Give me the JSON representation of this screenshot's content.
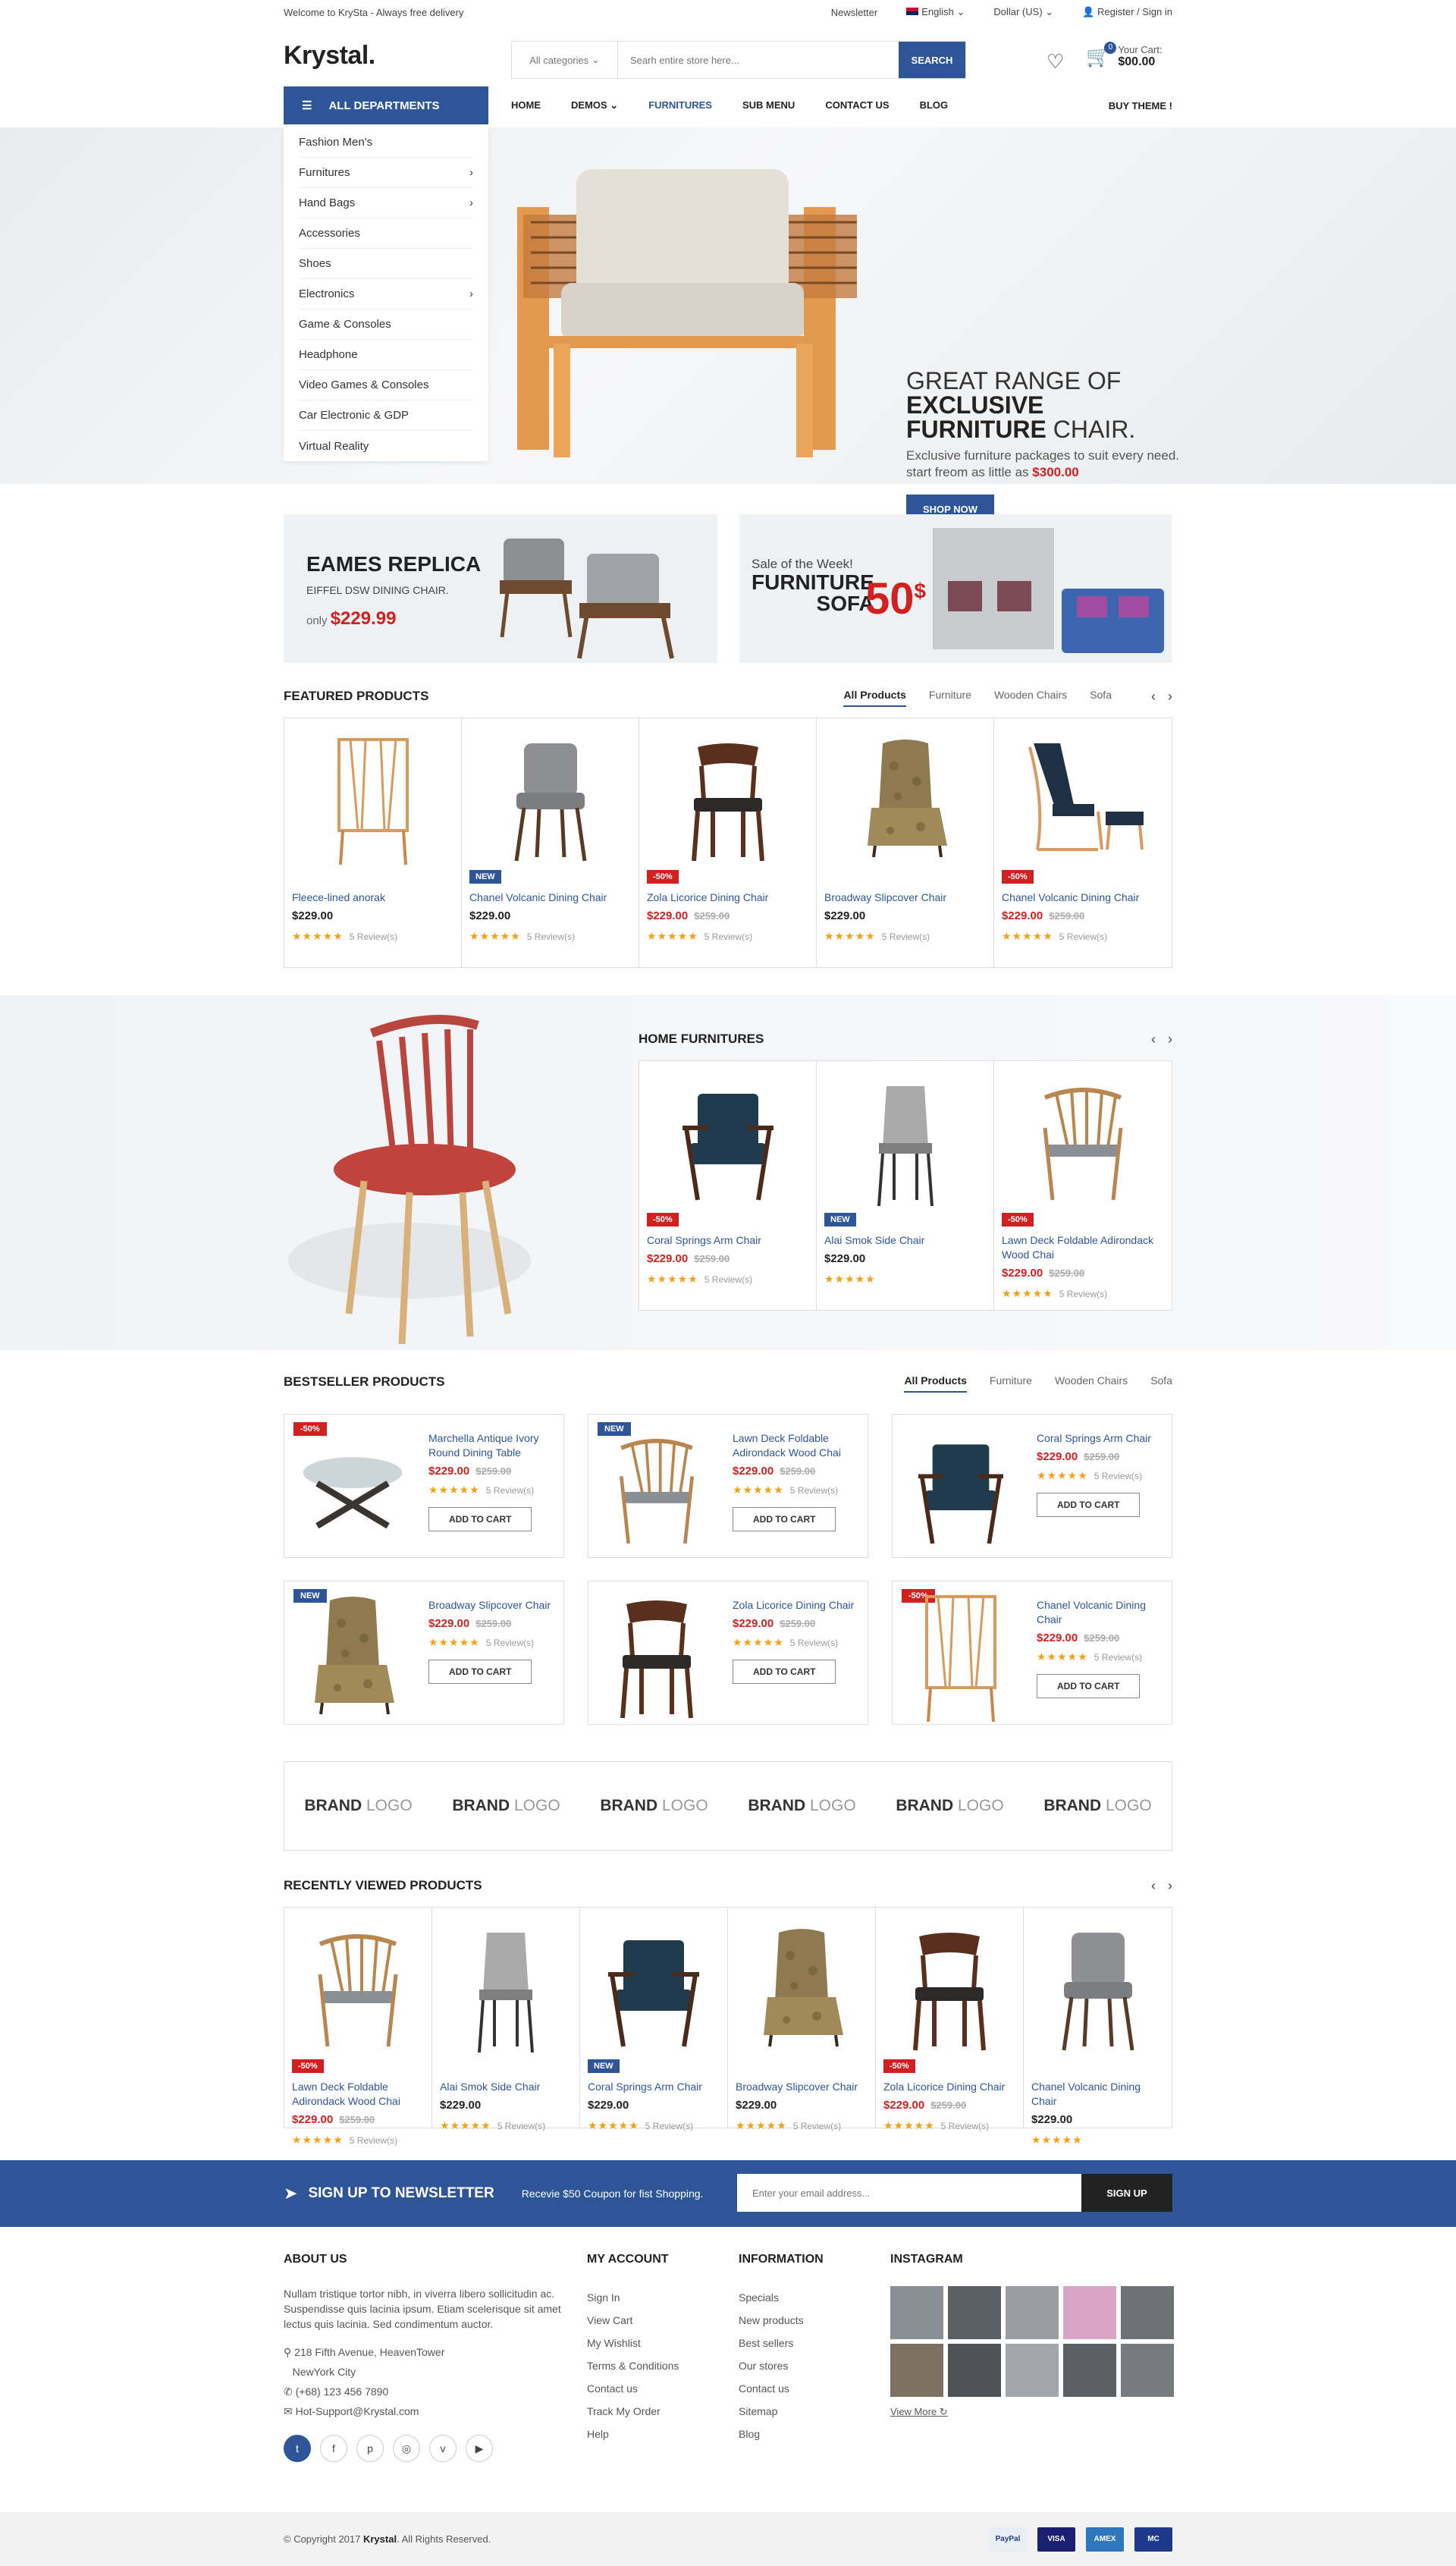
{
  "topbar": {
    "welcome": "Welcome to KrySta - Always free delivery",
    "newsletter": "Newsletter",
    "language": "English",
    "currency": "Dollar (US)",
    "account": "Register / Sign in"
  },
  "header": {
    "logo": "Krystal.",
    "category": "All categories",
    "search_placeholder": "Searh entire store here...",
    "search_button": "SEARCH",
    "cart_label": "Your Cart:",
    "cart_total": "$00.00",
    "cart_count": "0"
  },
  "nav": {
    "all_departments": "ALL DEPARTMENTS",
    "items": [
      "HOME",
      "DEMOS",
      "FURNITURES",
      "SUB MENU",
      "CONTACT US",
      "BLOG"
    ],
    "buy_theme": "BUY THEME !"
  },
  "departments": [
    "Fashion Men's",
    "Furnitures",
    "Hand Bags",
    "Accessories",
    "Shoes",
    "Electronics",
    "Game & Consoles",
    "Headphone",
    "Video Games & Consoles",
    "Car Electronic & GDP",
    "Virtual Reality"
  ],
  "hero": {
    "line1a": "GREAT RANGE OF ",
    "line1b": "EXCLUSIVE",
    "line2a": "FURNITURE",
    "line2b": " CHAIR.",
    "desc": "Exclusive furniture packages to suit every need.",
    "desc2": "start freom as little as ",
    "price": "$300.00",
    "button": "SHOP NOW"
  },
  "banner1": {
    "title": "EAMES REPLICA",
    "subtitle": "EIFFEL DSW DINING CHAIR.",
    "only": "only ",
    "price": "$229.99"
  },
  "banner2": {
    "sale": "Sale of the Week!",
    "line1": "FURNITURE",
    "line2": "SOFA",
    "value": "50",
    "currency": "$"
  },
  "featured": {
    "title": "FEATURED PRODUCTS",
    "tabs": [
      "All Products",
      "Furniture",
      "Wooden Chairs",
      "Sofa"
    ],
    "items": [
      {
        "name": "Fleece-lined anorak",
        "price": "$229.00",
        "old": "",
        "tag": "",
        "reviews": "5 Review(s)"
      },
      {
        "name": "Chanel Volcanic Dining Chair",
        "price": "$229.00",
        "old": "",
        "tag": "NEW",
        "reviews": "5 Review(s)"
      },
      {
        "name": "Zola Licorice Dining Chair",
        "price": "$229.00",
        "old": "$259.00",
        "tag": "-50%",
        "reviews": "5 Review(s)"
      },
      {
        "name": "Broadway Slipcover Chair",
        "price": "$229.00",
        "old": "",
        "tag": "",
        "reviews": "5 Review(s)"
      },
      {
        "name": "Chanel Volcanic Dining Chair",
        "price": "$229.00",
        "old": "$259.00",
        "tag": "-50%",
        "reviews": "5 Review(s)"
      }
    ]
  },
  "home": {
    "title": "HOME FURNITURES",
    "items": [
      {
        "name": "Coral Springs Arm Chair",
        "price": "$229.00",
        "old": "$259.00",
        "tag": "-50%",
        "reviews": "5 Review(s)"
      },
      {
        "name": "Alai Smok Side Chair",
        "price": "$229.00",
        "old": "",
        "tag": "NEW",
        "reviews": ""
      },
      {
        "name": "Lawn Deck Foldable Adirondack Wood Chai",
        "price": "$229.00",
        "old": "$259.00",
        "tag": "-50%",
        "reviews": "5 Review(s)"
      }
    ]
  },
  "bestseller": {
    "title": "BESTSELLER PRODUCTS",
    "tabs": [
      "All Products",
      "Furniture",
      "Wooden Chairs",
      "Sofa"
    ],
    "add_to_cart": "ADD TO CART",
    "items": [
      {
        "name": "Marchella Antique Ivory Round Dining Table",
        "price": "$229.00",
        "old": "$259.00",
        "tag": "-50%",
        "reviews": "5 Review(s)"
      },
      {
        "name": "Lawn Deck Foldable Adirondack Wood Chai",
        "price": "$229.00",
        "old": "$259.00",
        "tag": "NEW",
        "reviews": "5 Review(s)"
      },
      {
        "name": "Coral Springs Arm Chair",
        "price": "$229.00",
        "old": "$259.00",
        "tag": "",
        "reviews": "5 Review(s)"
      },
      {
        "name": "Broadway Slipcover Chair",
        "price": "$229.00",
        "old": "$259.00",
        "tag": "NEW",
        "reviews": "5 Review(s)"
      },
      {
        "name": "Zola Licorice Dining Chair",
        "price": "$229.00",
        "old": "$259.00",
        "tag": "",
        "reviews": "5 Review(s)"
      },
      {
        "name": "Chanel Volcanic Dining Chair",
        "price": "$229.00",
        "old": "$259.00",
        "tag": "-50%",
        "reviews": "5 Review(s)"
      }
    ]
  },
  "brands": {
    "bold": "BRAND",
    "light": "LOGO"
  },
  "recent": {
    "title": "RECENTLY VIEWED PRODUCTS",
    "items": [
      {
        "name": "Lawn Deck Foldable Adirondack Wood Chai",
        "price": "$229.00",
        "old": "$259.00",
        "tag": "-50%",
        "reviews": "5 Review(s)"
      },
      {
        "name": "Alai Smok Side Chair",
        "price": "$229.00",
        "old": "",
        "tag": "",
        "reviews": "5 Review(s)"
      },
      {
        "name": "Coral Springs Arm Chair",
        "price": "$229.00",
        "old": "",
        "tag": "NEW",
        "reviews": "5 Review(s)"
      },
      {
        "name": "Broadway Slipcover Chair",
        "price": "$229.00",
        "old": "",
        "tag": "",
        "reviews": "5 Review(s)"
      },
      {
        "name": "Zola Licorice Dining Chair",
        "price": "$229.00",
        "old": "$259.00",
        "tag": "-50%",
        "reviews": "5 Review(s)"
      },
      {
        "name": "Chanel Volcanic Dining Chair",
        "price": "$229.00",
        "old": "",
        "tag": "",
        "reviews": ""
      }
    ]
  },
  "newsletter": {
    "title": "SIGN UP TO NEWSLETTER",
    "subtitle": "Recevie $50 Coupon for fist Shopping.",
    "placeholder": "Enter your email address...",
    "button": "SIGN UP"
  },
  "footer": {
    "about_title": "ABOUT US",
    "about_text": "Nullam tristique tortor nibh, in viverra libero sollicitudin ac. Suspendisse quis lacinia ipsum. Etiam scelerisque sit amet lectus quis lacinia. Sed condimentum auctor.",
    "address1": "218 Fifth Avenue, HeavenTower",
    "address2": "NewYork City",
    "phone": "(+68) 123 456 7890",
    "email": "Hot-Support@Krystal.com",
    "account_title": "MY ACCOUNT",
    "account": [
      "Sign In",
      "View Cart",
      "My Wishlist",
      "Terms & Conditions",
      "Contact us",
      "Track My Order",
      "Help"
    ],
    "info_title": "INFORMATION",
    "info": [
      "Specials",
      "New products",
      "Best sellers",
      "Our stores",
      "Contact us",
      "Sitemap",
      "Blog"
    ],
    "insta_title": "INSTAGRAM",
    "view_more": "View More",
    "copyright_a": "© Copyright 2017 ",
    "copyright_b": "Krystal",
    "copyright_c": ". All Rights Reserved.",
    "payments": [
      "PayPal",
      "VISA",
      "AMEX",
      "MC"
    ]
  },
  "colors": {
    "accent": "#2e5597",
    "sale": "#d21f1f",
    "stars": "#f2a118"
  }
}
